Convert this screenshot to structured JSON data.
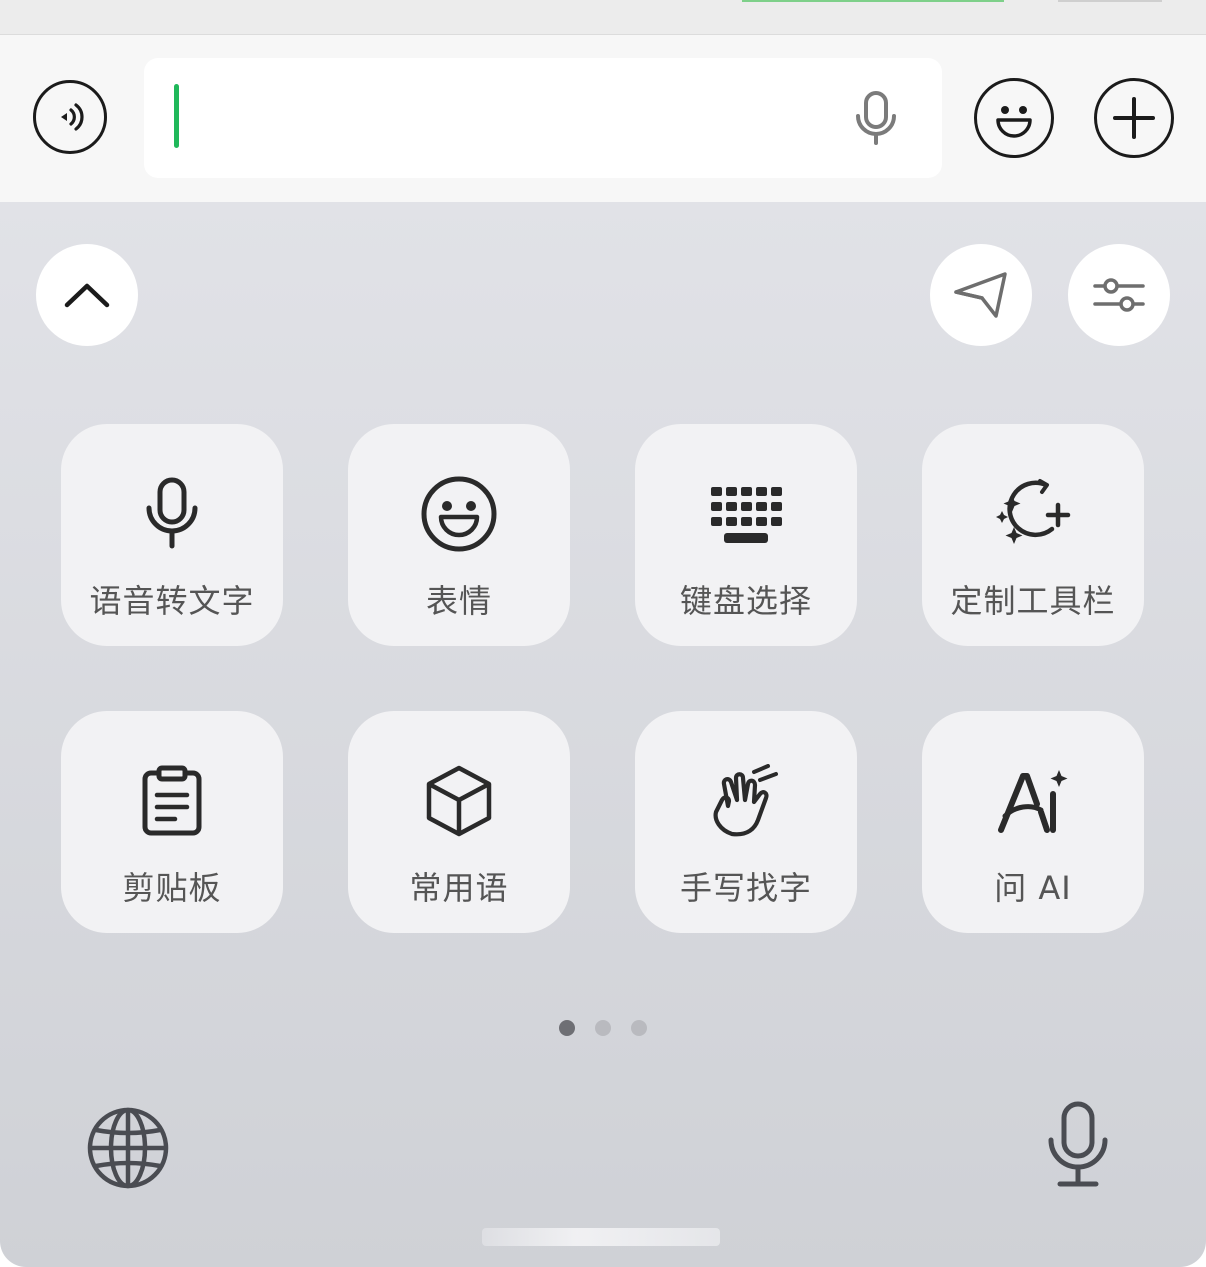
{
  "input_bar": {
    "voice_toggle_icon": "voice-wave-icon",
    "field_value": "",
    "field_mic_icon": "microphone-icon",
    "emoji_icon": "smiley-icon",
    "plus_icon": "plus-icon"
  },
  "panel": {
    "collapse_icon": "chevron-up-icon",
    "send_icon": "paper-plane-icon",
    "settings_icon": "sliders-icon",
    "tiles": [
      {
        "label": "语音转文字",
        "icon": "microphone-icon"
      },
      {
        "label": "表情",
        "icon": "smiley-icon"
      },
      {
        "label": "键盘选择",
        "icon": "keyboard-icon"
      },
      {
        "label": "定制工具栏",
        "icon": "sparkle-moon-plus-icon"
      },
      {
        "label": "剪贴板",
        "icon": "clipboard-icon"
      },
      {
        "label": "常用语",
        "icon": "cube-icon"
      },
      {
        "label": "手写找字",
        "icon": "hand-gesture-icon"
      },
      {
        "label": "问 AI",
        "icon": "ai-sparkle-icon"
      }
    ],
    "page_indicator": {
      "pages": 3,
      "current": 1
    },
    "globe_icon": "globe-icon",
    "dictation_icon": "microphone-icon"
  },
  "colors": {
    "accent_caret": "#20b85a",
    "panel_bg": "#dcdde2",
    "tile_bg": "#f2f2f4",
    "label_text": "#555555",
    "icon_dark": "#1b1b1b"
  }
}
